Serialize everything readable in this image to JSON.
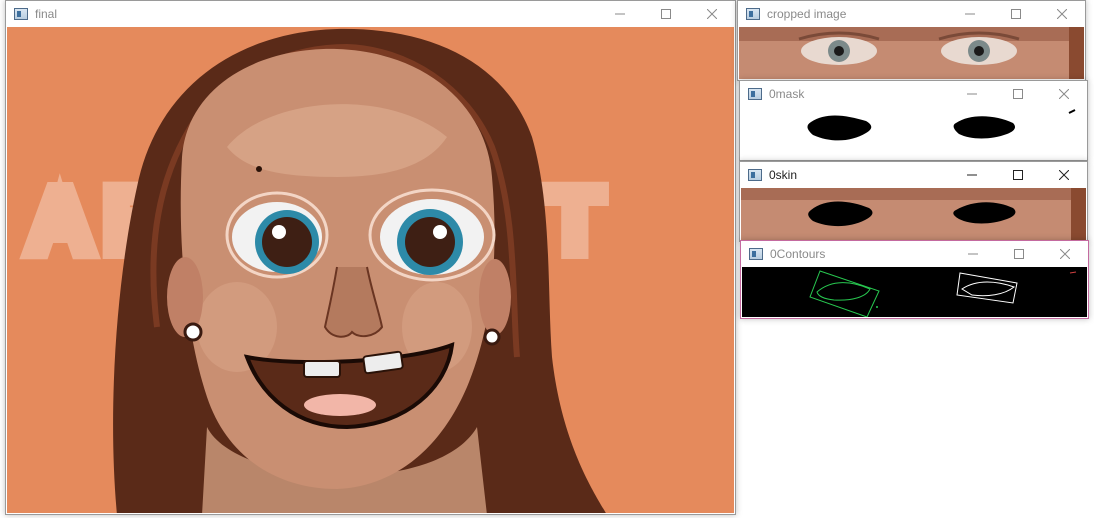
{
  "windows": {
    "final": {
      "title": "final"
    },
    "cropped": {
      "title": "cropped image"
    },
    "mask": {
      "title": "0mask"
    },
    "skin": {
      "title": "0skin"
    },
    "contours": {
      "title": "0Contours"
    }
  },
  "background_text": "ABSTRACT",
  "colors": {
    "orange_bg": "#e58a5c",
    "skin": "#c98f72",
    "hair": "#5a2a18",
    "contour_green": "#28c850",
    "contour_white": "#ffffff"
  },
  "icons": {
    "minimize": "minimize-icon",
    "maximize": "maximize-icon",
    "close": "close-icon",
    "app": "window-app-icon"
  }
}
